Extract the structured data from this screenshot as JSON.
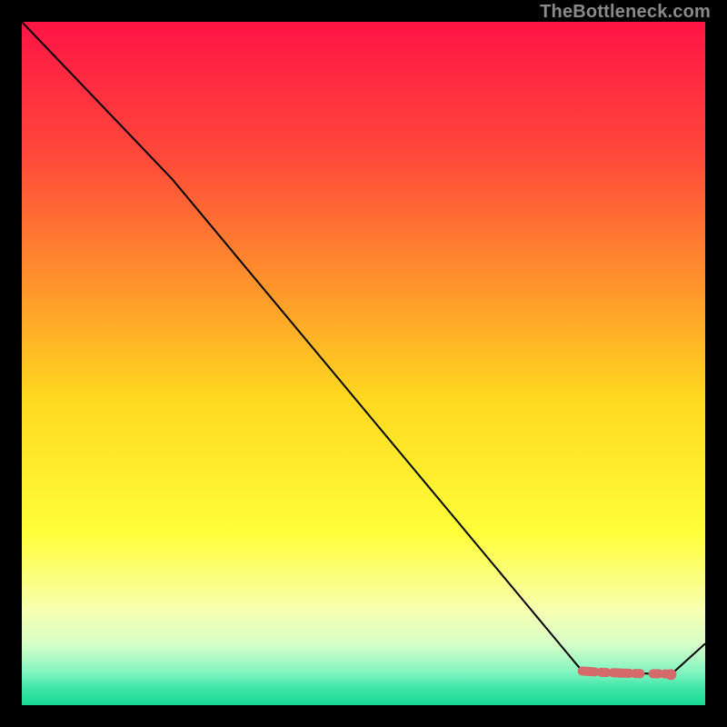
{
  "watermark": "TheBottleneck.com",
  "chart_data": {
    "type": "line",
    "title": "",
    "xlabel": "",
    "ylabel": "",
    "xlim": [
      0,
      100
    ],
    "ylim": [
      0,
      100
    ],
    "series": [
      {
        "name": "bottleneck-curve",
        "x": [
          0,
          22,
          82,
          95,
          100
        ],
        "y": [
          100,
          77,
          5,
          4.5,
          9
        ],
        "color": "#000000"
      },
      {
        "name": "marker-band",
        "x": [
          82,
          85,
          88,
          91,
          94,
          95
        ],
        "y": [
          5,
          4.8,
          4.7,
          4.6,
          4.6,
          4.5
        ],
        "color": "#d46a6a"
      }
    ],
    "gradient_stops": [
      {
        "pos": 0.0,
        "color": "#ff1445"
      },
      {
        "pos": 0.2,
        "color": "#ff4a3a"
      },
      {
        "pos": 0.4,
        "color": "#ff9a2a"
      },
      {
        "pos": 0.55,
        "color": "#ffd81f"
      },
      {
        "pos": 0.75,
        "color": "#ffff3a"
      },
      {
        "pos": 0.86,
        "color": "#f7ffb0"
      },
      {
        "pos": 0.91,
        "color": "#d8ffc8"
      },
      {
        "pos": 0.95,
        "color": "#86f5c1"
      },
      {
        "pos": 0.975,
        "color": "#3fe6a8"
      },
      {
        "pos": 1.0,
        "color": "#16d892"
      }
    ]
  }
}
